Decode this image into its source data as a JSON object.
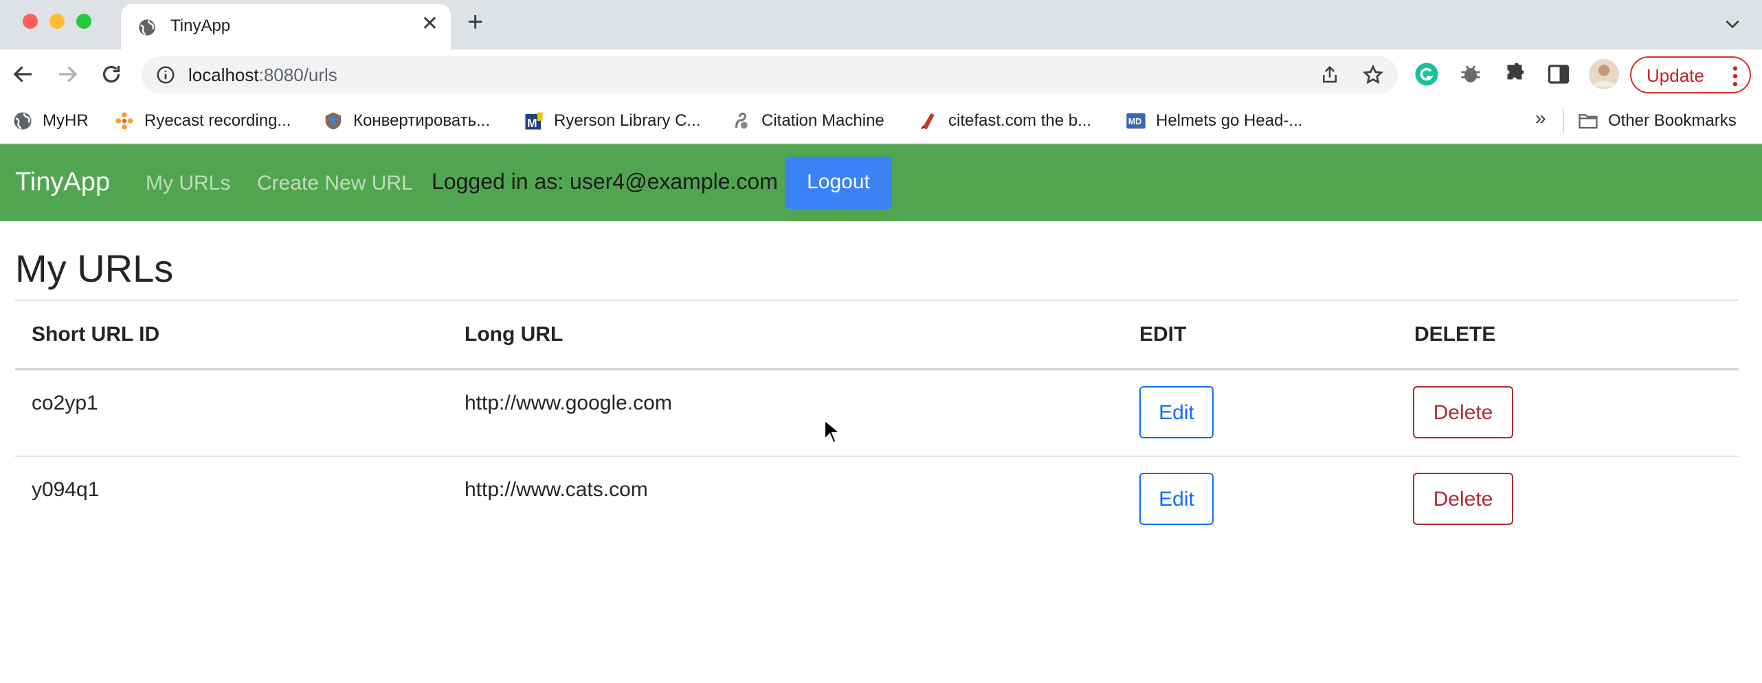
{
  "browser": {
    "tab_title": "TinyApp",
    "url_host": "localhost",
    "url_path": ":8080/urls",
    "update_label": "Update",
    "bookmarks": [
      {
        "label": "MyHR",
        "icon": "globe-icon"
      },
      {
        "label": "Ryecast recording...",
        "icon": "ryecast-icon"
      },
      {
        "label": "Конвертировать...",
        "icon": "shield-crest-icon"
      },
      {
        "label": "Ryerson Library C...",
        "icon": "ryerson-m-icon"
      },
      {
        "label": "Citation Machine",
        "icon": "squirrel-icon"
      },
      {
        "label": "citefast.com the b...",
        "icon": "citefast-icon"
      },
      {
        "label": "Helmets go Head-...",
        "icon": "md-icon"
      }
    ],
    "more_bookmarks": "»",
    "other_bookmarks": "Other Bookmarks"
  },
  "navbar": {
    "brand": "TinyApp",
    "links": [
      "My URLs",
      "Create New URL"
    ],
    "logged_in_text": "Logged in as: user4@example.com",
    "logout_label": "Logout",
    "color": "#52a550"
  },
  "main": {
    "title": "My URLs",
    "table": {
      "headers": [
        "Short URL ID",
        "Long URL",
        "EDIT",
        "DELETE"
      ],
      "rows": [
        {
          "short_id": "co2yp1",
          "long_url": "http://www.google.com",
          "edit_label": "Edit",
          "delete_label": "Delete"
        },
        {
          "short_id": "y094q1",
          "long_url": "http://www.cats.com",
          "edit_label": "Edit",
          "delete_label": "Delete"
        }
      ]
    }
  }
}
